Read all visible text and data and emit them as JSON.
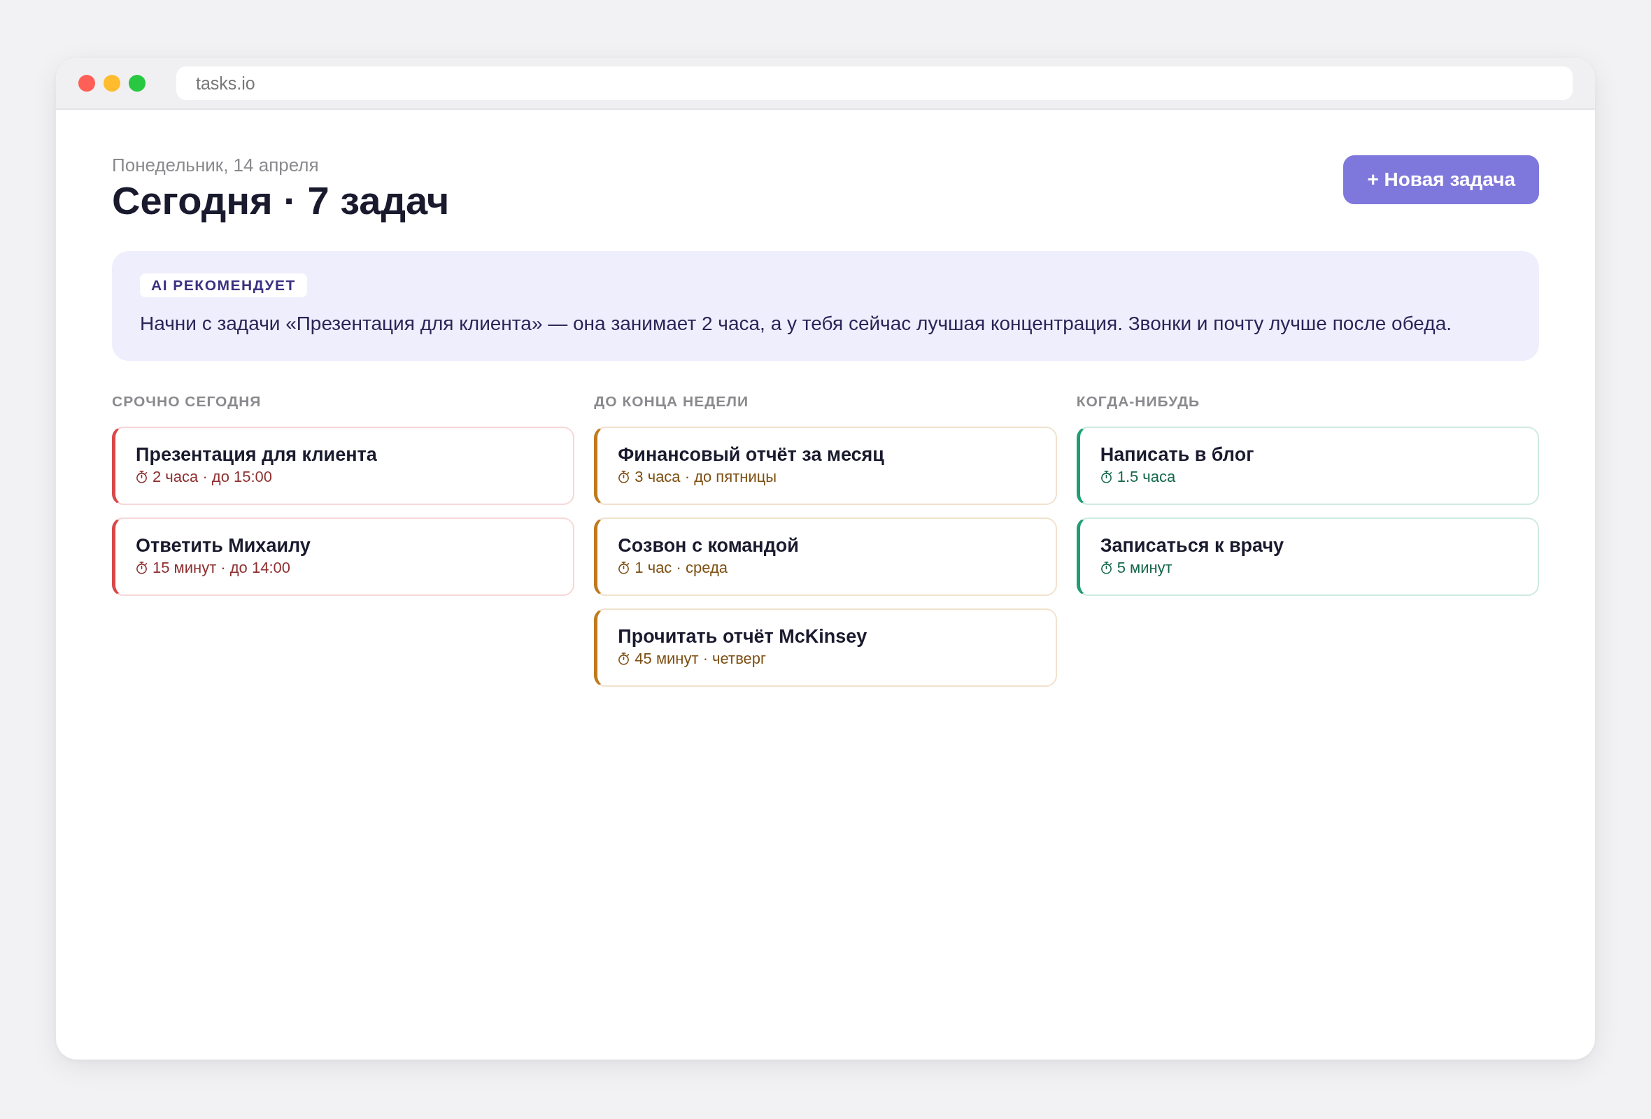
{
  "browser": {
    "url": "tasks.io"
  },
  "header": {
    "date": "Понедельник, 14 апреля",
    "title": "Сегодня · 7 задач",
    "new_task_button": "+ Новая задача"
  },
  "ai_recommendation": {
    "badge": "AI РЕКОМЕНДУЕТ",
    "text": "Начни с задачи «Презентация для клиента» — она занимает 2 часа, а у тебя сейчас лучшая концентрация. Звонки и почту лучше после обеда."
  },
  "columns": [
    {
      "title": "СРОЧНО СЕГОДНЯ",
      "color": "#d94848",
      "tasks": [
        {
          "title": "Презентация для клиента",
          "meta": "2 часа · до 15:00"
        },
        {
          "title": "Ответить Михаилу",
          "meta": "15 минут · до 14:00"
        }
      ]
    },
    {
      "title": "ДО КОНЦА НЕДЕЛИ",
      "color": "#c07a1c",
      "tasks": [
        {
          "title": "Финансовый отчёт за месяц",
          "meta": "3 часа · до пятницы"
        },
        {
          "title": "Созвон с командой",
          "meta": "1 час · среда"
        },
        {
          "title": "Прочитать отчёт McKinsey",
          "meta": "45 минут · четверг"
        }
      ]
    },
    {
      "title": "КОГДА-НИБУДЬ",
      "color": "#1f9e74",
      "tasks": [
        {
          "title": "Написать в блог",
          "meta": "1.5 часа"
        },
        {
          "title": "Записаться к врачу",
          "meta": "5 минут"
        }
      ]
    }
  ]
}
